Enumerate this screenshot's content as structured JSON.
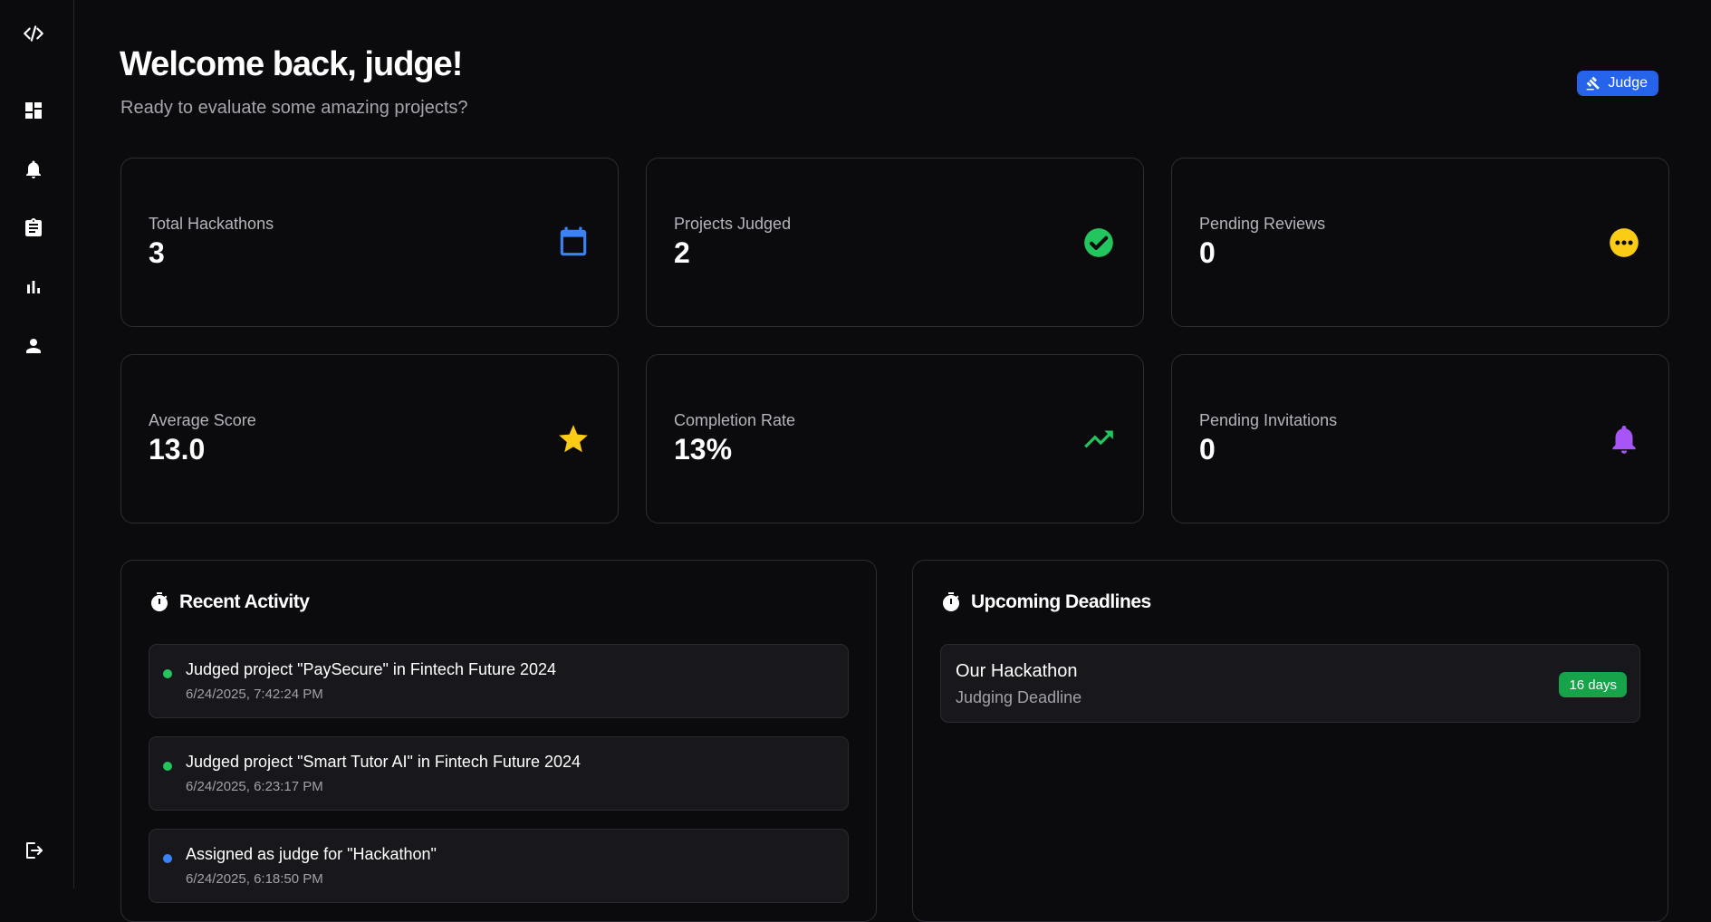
{
  "sidebar": {
    "items": [
      {
        "icon": "code-icon"
      },
      {
        "icon": "dashboard-icon"
      },
      {
        "icon": "bell-icon"
      },
      {
        "icon": "clipboard-icon"
      },
      {
        "icon": "bar-chart-icon"
      },
      {
        "icon": "user-icon"
      }
    ],
    "logout_icon": "logout-icon"
  },
  "header": {
    "title": "Welcome back, judge!",
    "subtitle": "Ready to evaluate some amazing projects?",
    "role_badge": "Judge",
    "role_badge_color": "#2563eb"
  },
  "stats": [
    {
      "label": "Total Hackathons",
      "value": "3",
      "icon": "calendar-icon",
      "color": "#3b82f6"
    },
    {
      "label": "Projects Judged",
      "value": "2",
      "icon": "check-circle-icon",
      "color": "#22c55e"
    },
    {
      "label": "Pending Reviews",
      "value": "0",
      "icon": "more-circle-icon",
      "color": "#facc15"
    },
    {
      "label": "Average Score",
      "value": "13.0",
      "icon": "star-icon",
      "color": "#facc15"
    },
    {
      "label": "Completion Rate",
      "value": "13%",
      "icon": "trending-up-icon",
      "color": "#22c55e"
    },
    {
      "label": "Pending Invitations",
      "value": "0",
      "icon": "bell-icon",
      "color": "#a855f7"
    }
  ],
  "recent_activity": {
    "title": "Recent Activity",
    "items": [
      {
        "text": "Judged project \"PaySecure\" in Fintech Future 2024",
        "time": "6/24/2025, 7:42:24 PM",
        "dot_color": "#22c55e"
      },
      {
        "text": "Judged project \"Smart Tutor AI\" in Fintech Future 2024",
        "time": "6/24/2025, 6:23:17 PM",
        "dot_color": "#22c55e"
      },
      {
        "text": "Assigned as judge for \"Hackathon\"",
        "time": "6/24/2025, 6:18:50 PM",
        "dot_color": "#3b82f6"
      }
    ]
  },
  "upcoming_deadlines": {
    "title": "Upcoming Deadlines",
    "items": [
      {
        "name": "Our Hackathon",
        "type": "Judging Deadline",
        "badge": "16 days",
        "badge_color": "#16a34a"
      }
    ]
  }
}
